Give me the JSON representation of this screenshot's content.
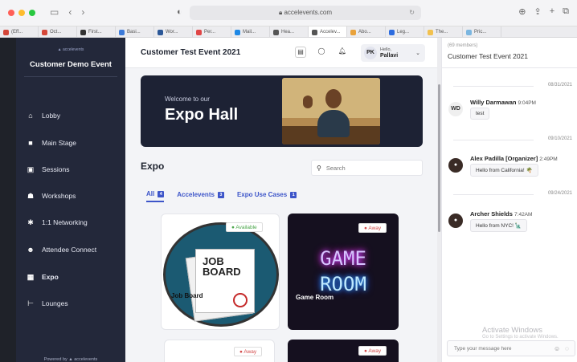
{
  "browser": {
    "url": "accelevents.com",
    "tabs": [
      {
        "label": "(Eff...",
        "color": "#d44638"
      },
      {
        "label": "Oct...",
        "color": "#d44638"
      },
      {
        "label": "First...",
        "color": "#333333"
      },
      {
        "label": "Basi...",
        "color": "#3d7bd9"
      },
      {
        "label": "Wor...",
        "color": "#2b5797"
      },
      {
        "label": "Per...",
        "color": "#e04646"
      },
      {
        "label": "Mail...",
        "color": "#1e88e5"
      },
      {
        "label": "Hea...",
        "color": "#555555"
      },
      {
        "label": "Accelev...",
        "color": "#555555"
      },
      {
        "label": "Abo...",
        "color": "#e9a23b"
      },
      {
        "label": "Leg...",
        "color": "#2d6cdf"
      },
      {
        "label": "The...",
        "color": "#f2c14e"
      },
      {
        "label": "Pric...",
        "color": "#7bb6e0"
      }
    ]
  },
  "sidebar": {
    "logo": "accelevents",
    "event_title": "Customer Demo Event",
    "items": [
      {
        "label": "Lobby",
        "icon": "home-icon"
      },
      {
        "label": "Main Stage",
        "icon": "video-icon"
      },
      {
        "label": "Sessions",
        "icon": "calendar-icon"
      },
      {
        "label": "Workshops",
        "icon": "users-icon"
      },
      {
        "label": "1:1 Networking",
        "icon": "networking-icon"
      },
      {
        "label": "Attendee Connect",
        "icon": "user-icon"
      },
      {
        "label": "Expo",
        "icon": "grid-icon"
      },
      {
        "label": "Lounges",
        "icon": "lounge-icon"
      }
    ],
    "powered_by": "Powered by  ▲ accelevents"
  },
  "header": {
    "title": "Customer Test Event 2021",
    "user_initials": "PK",
    "hello": "Hello,",
    "user_name": "Pallavi"
  },
  "banner": {
    "welcome": "Welcome to our",
    "title": "Expo Hall"
  },
  "expo": {
    "heading": "Expo",
    "search_placeholder": "Search",
    "filters": [
      {
        "label": "All",
        "count": "4"
      },
      {
        "label": "Accelevents",
        "count": "3"
      },
      {
        "label": "Expo Use Cases",
        "count": "1"
      }
    ],
    "cards": [
      {
        "name": "Job Board",
        "status": "Available",
        "art": "JOB BOARD"
      },
      {
        "name": "Game Room",
        "status": "Away",
        "art1": "GAME",
        "art2": "ROOM"
      },
      {
        "name": "",
        "status": "Away"
      },
      {
        "name": "",
        "status": "Away"
      }
    ]
  },
  "chat": {
    "members": "(69 members)",
    "title": "Customer Test Event 2021",
    "dates": [
      "08/31/2021",
      "09/10/2021",
      "09/24/2021"
    ],
    "messages": [
      {
        "initials": "WD",
        "name": "Willy Darmawan",
        "time": "9:04PM",
        "text": "test"
      },
      {
        "initials": "AP",
        "name": "Alex Padilla [Organizer]",
        "time": "2:49PM",
        "text": "Hello from California! 🌴"
      },
      {
        "initials": "AS",
        "name": "Archer Shields",
        "time": "7:42AM",
        "text": "Hello from NYC! 🗽"
      }
    ],
    "input_placeholder": "Type your message here",
    "watermark_title": "Activate Windows",
    "watermark_sub": "Go to Settings to activate Windows."
  }
}
